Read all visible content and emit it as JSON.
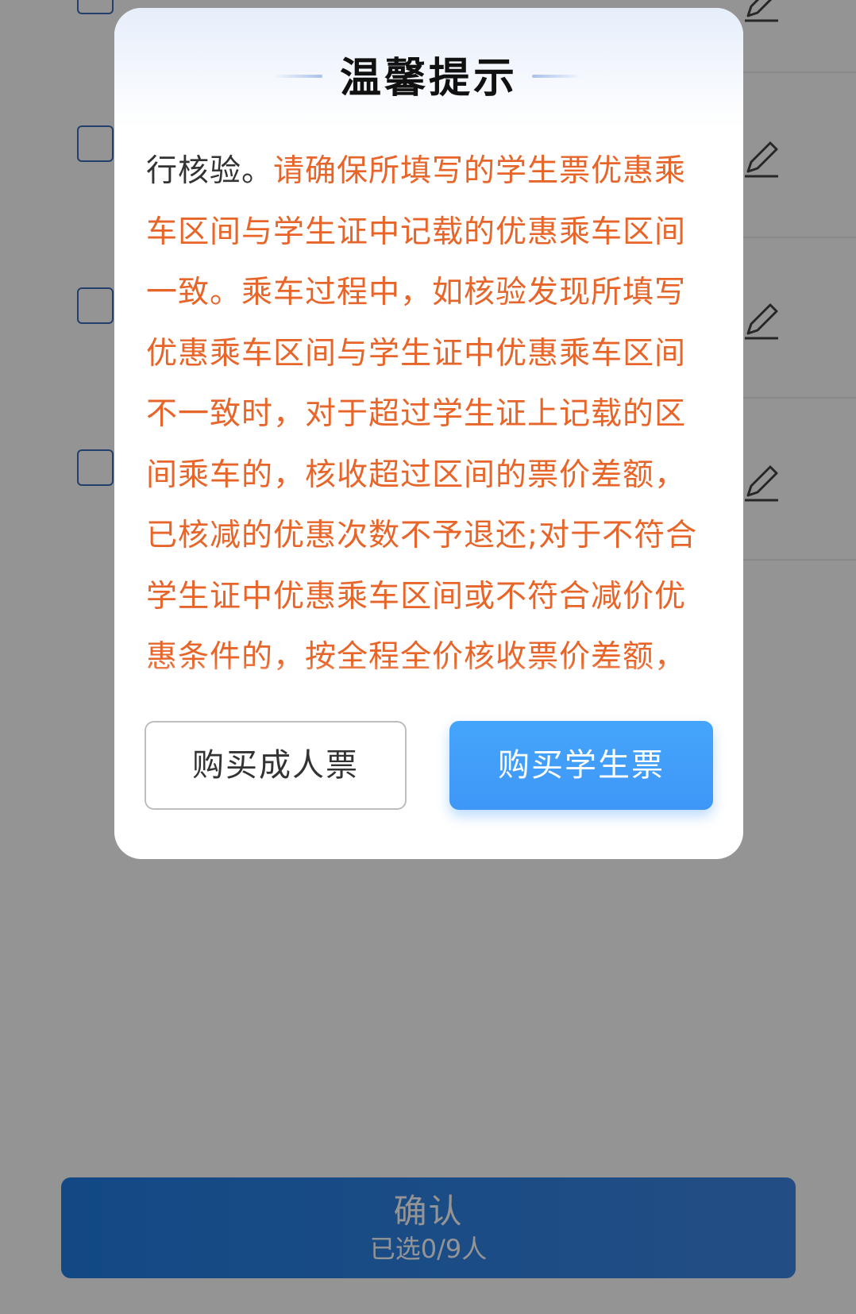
{
  "modal": {
    "title": "温馨提示",
    "body_normal": "行核验。",
    "body_highlight": "请确保所填写的学生票优惠乘车区间与学生证中记载的优惠乘车区间一致。乘车过程中，如核验发现所填写优惠乘车区间与学生证中优惠乘车区间不一致时，对于超过学生证上记载的区间乘车的，核收超过区间的票价差额，已核减的优惠次数不予退还;对于不符合学生证中优惠乘车区间或不符合减价优惠条件的，按全程全价核收票价差额，",
    "buttons": {
      "adult": "购买成人票",
      "student": "购买学生票"
    }
  },
  "footer": {
    "confirm_label": "确认",
    "selected_count": "已选0/9人"
  },
  "colors": {
    "highlight_text": "#e8652a",
    "primary_blue": "#3e97f7",
    "confirm_blue": "#1f7fe6"
  },
  "icons": [
    "checkbox-icon",
    "edit-pencil-icon"
  ]
}
